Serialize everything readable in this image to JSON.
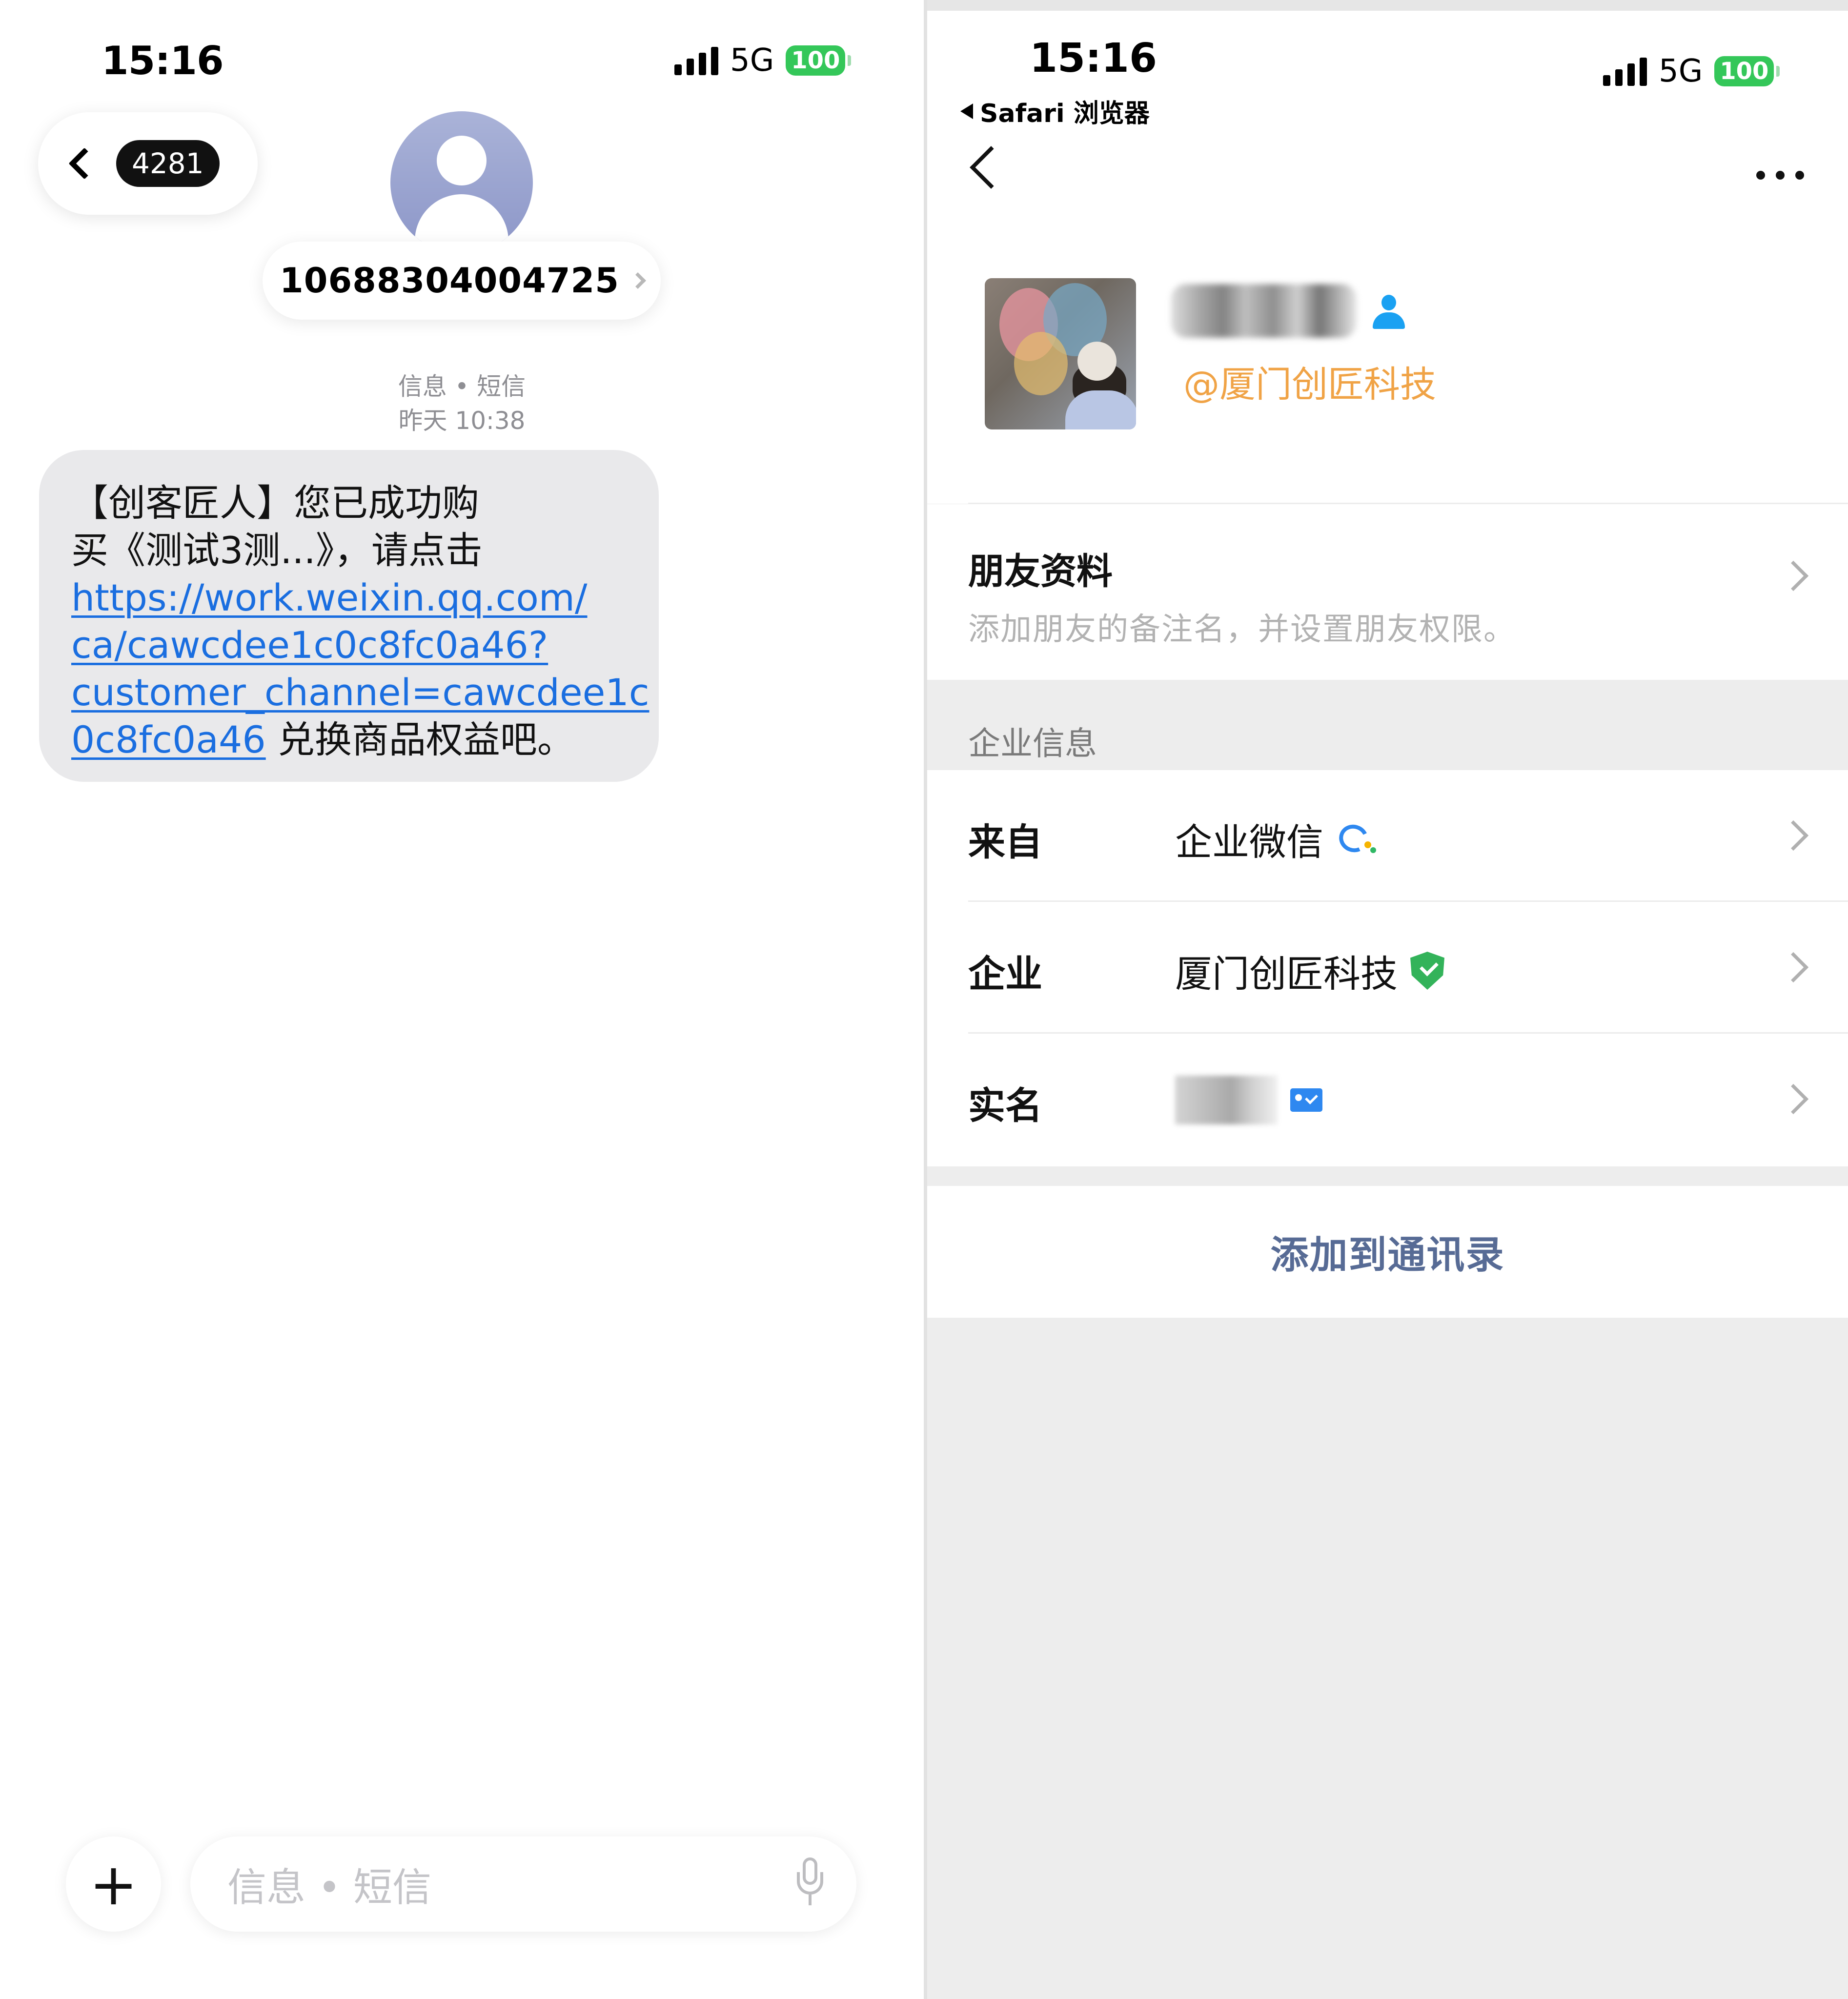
{
  "left": {
    "status": {
      "time": "15:16",
      "network": "5G",
      "battery": "100"
    },
    "back": {
      "count": "4281"
    },
    "contact": {
      "number": "10688304004725"
    },
    "meta": {
      "channel": "信息 • 短信",
      "timestamp": "昨天 10:38"
    },
    "message": {
      "line1": "【创客匠人】您已成功购",
      "line2": "买《测试3测...》，请点击",
      "link_line1": " https://work.weixin.qq.com/",
      "link_line2": "ca/cawcdee1c0c8fc0a46?",
      "link_line3": "customer_channel=cawcdee1c",
      "link_line4": "0c8fc0a46",
      "tail": " 兑换商品权益吧。"
    },
    "composer": {
      "placeholder": "信息 • 短信"
    }
  },
  "right": {
    "status": {
      "time": "15:16",
      "back_app": "Safari 浏览器",
      "network": "5G",
      "battery": "100"
    },
    "profile": {
      "company_tag": "@厦门创匠科技"
    },
    "friend_card": {
      "title": "朋友资料",
      "subtitle": "添加朋友的备注名，并设置朋友权限。"
    },
    "section_label": "企业信息",
    "rows": {
      "from": {
        "key": "来自",
        "value": "企业微信"
      },
      "corp": {
        "key": "企业",
        "value": "厦门创匠科技"
      },
      "realname": {
        "key": "实名"
      }
    },
    "add_button": "添加到通讯录"
  },
  "colors": {
    "link_blue": "#1a6ee0",
    "battery_green": "#34c759",
    "company_orange": "#f0a346",
    "action_blue_gray": "#576b95",
    "verified_green": "#33b35a"
  },
  "icons": [
    "signal-bars-icon",
    "chevron-left-icon",
    "contact-avatar-icon",
    "chevron-right-icon",
    "plus-icon",
    "microphone-icon",
    "more-icon",
    "person-icon",
    "wecom-logo-icon",
    "verified-shield-icon",
    "id-card-icon"
  ]
}
